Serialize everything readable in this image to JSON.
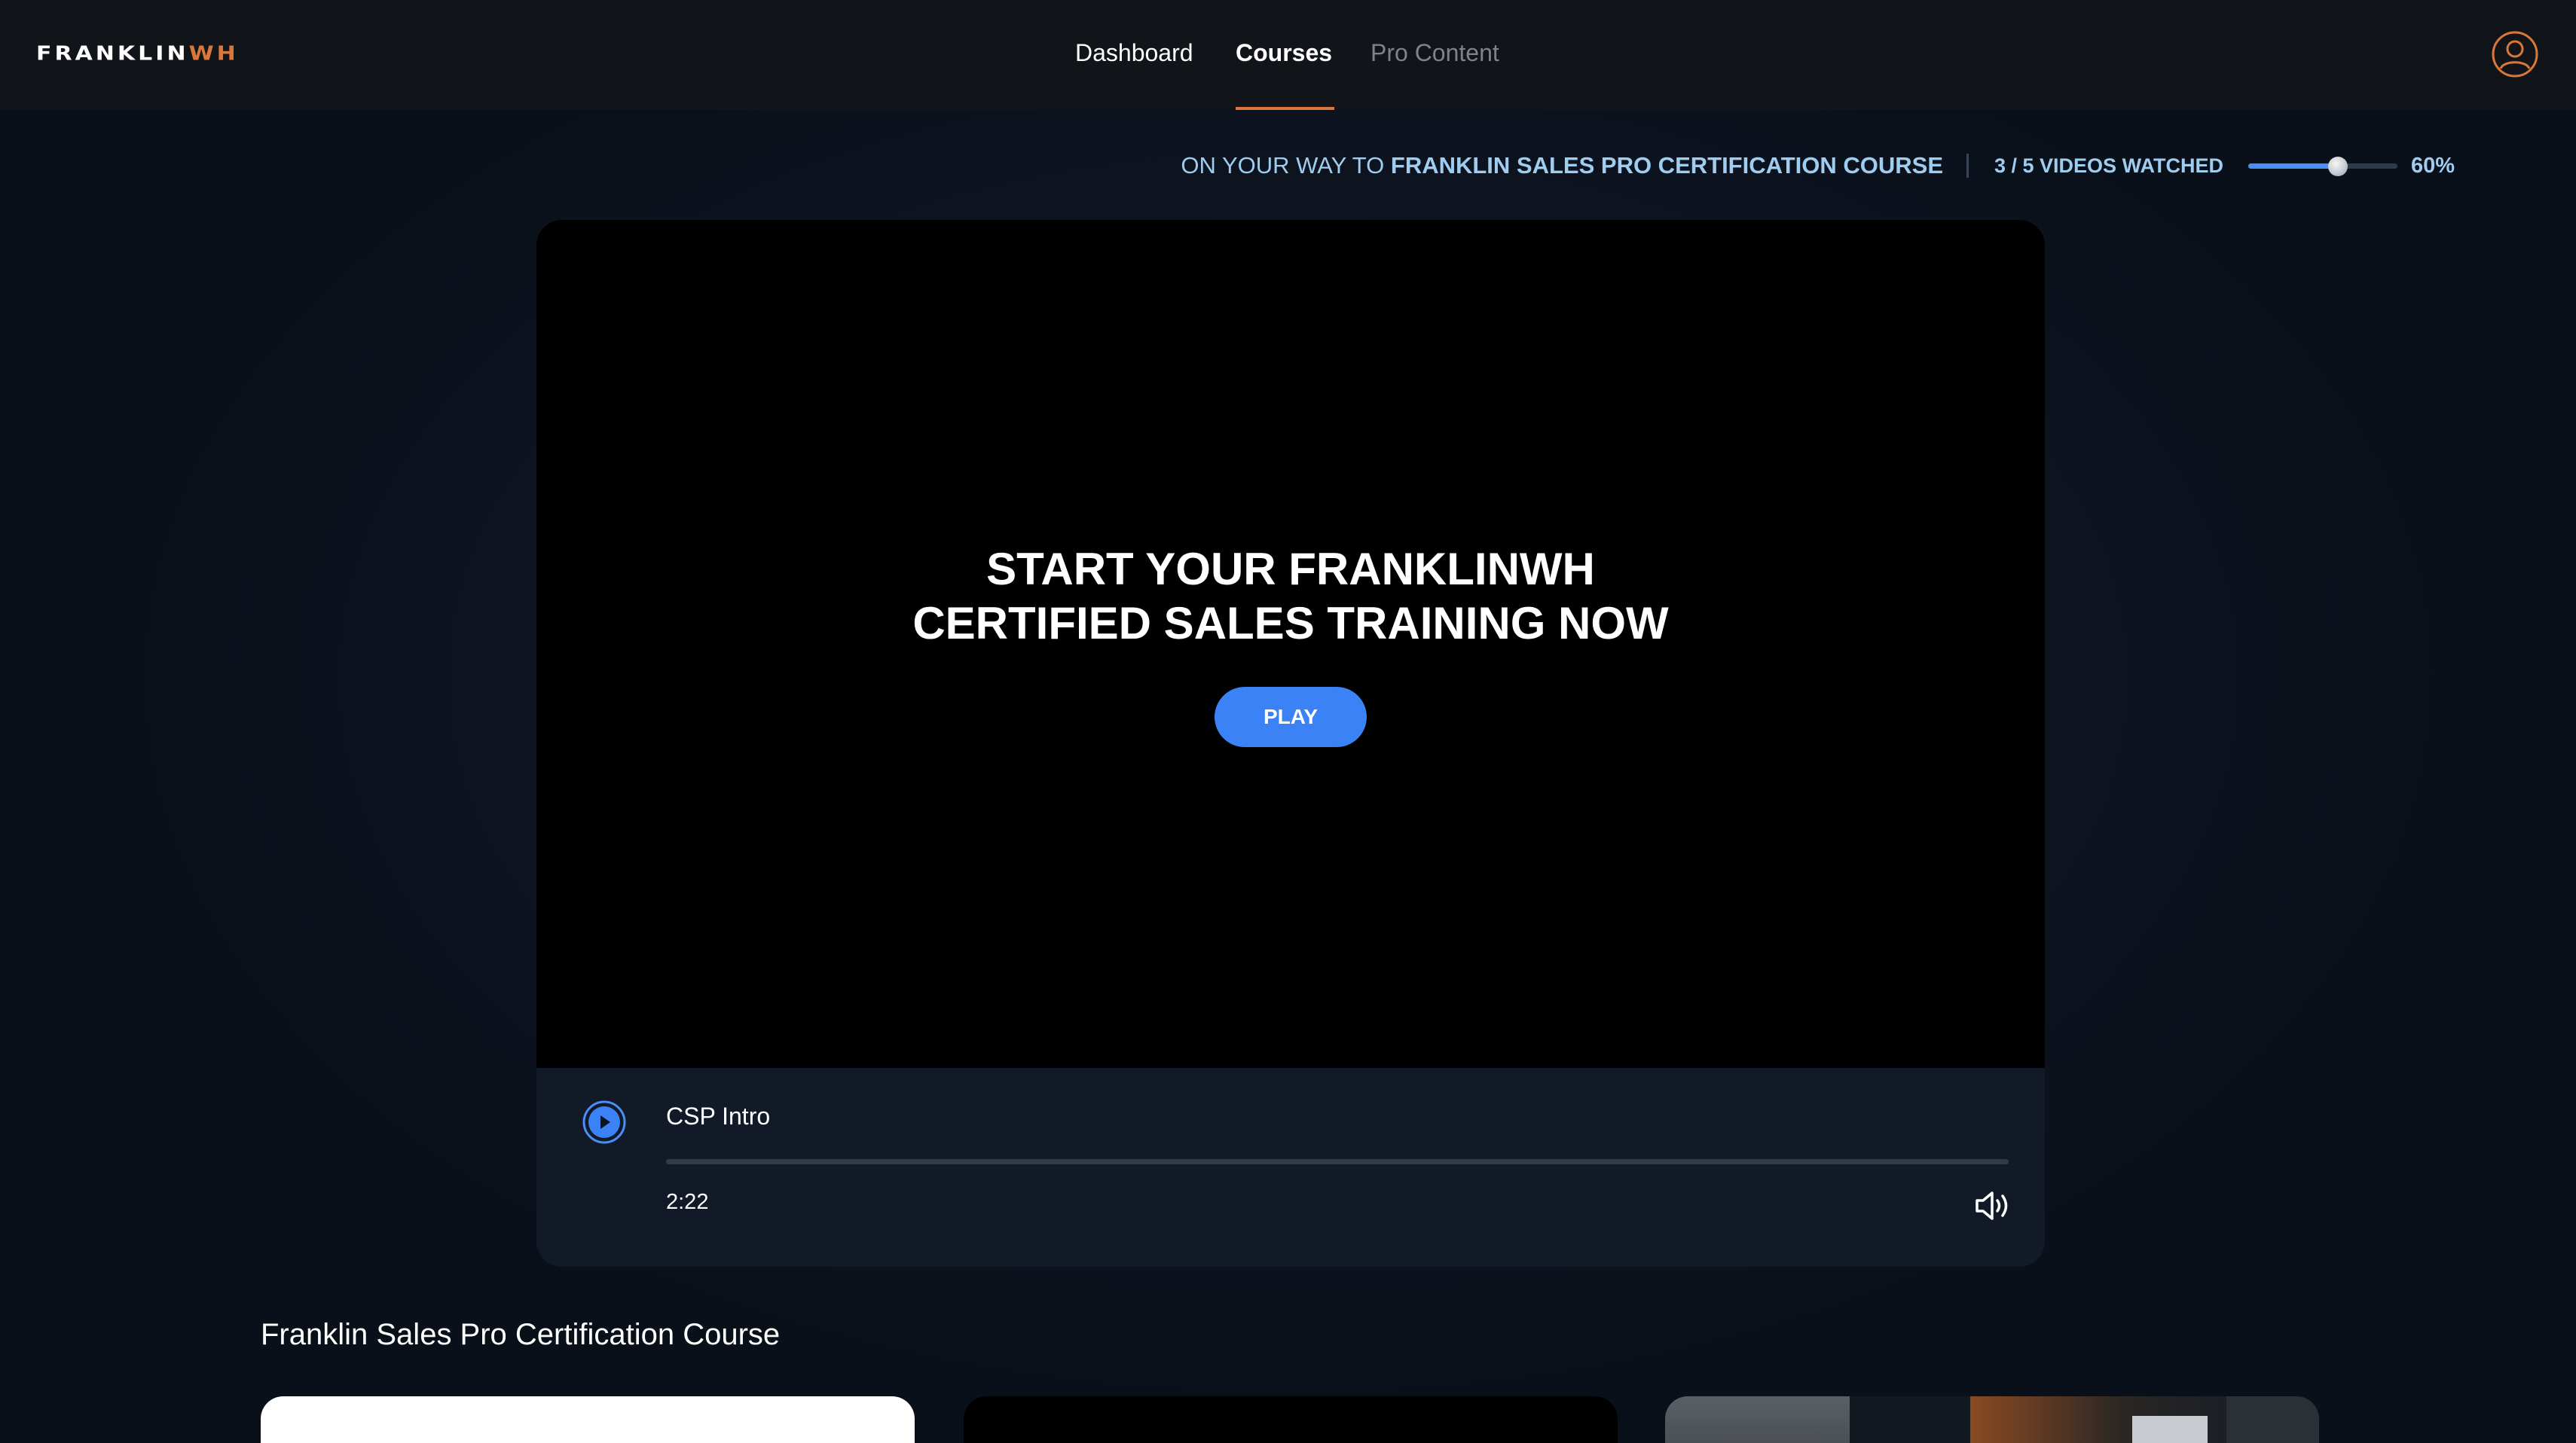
{
  "brand": {
    "logo_main": "FRANKLIN",
    "logo_accent": "WH",
    "accent_color": "#d9783a",
    "primary_color": "#3b82f6"
  },
  "nav": {
    "items": [
      {
        "label": "Dashboard",
        "active": false
      },
      {
        "label": "Courses",
        "active": true
      },
      {
        "label": "Pro Content",
        "active": false
      }
    ],
    "account_icon": "user-circle-icon"
  },
  "progress": {
    "prefix": "ON YOUR WAY TO",
    "course_name": "FRANKLIN SALES PRO CERTIFICATION COURSE",
    "watched_label": "3 / 5 VIDEOS WATCHED",
    "percent_label": "60%",
    "fraction": 0.6
  },
  "player": {
    "headline_line1": "START YOUR FRANKLINWH",
    "headline_line2": "CERTIFIED SALES TRAINING NOW",
    "play_label": "PLAY",
    "video_title": "CSP Intro",
    "duration": "2:22",
    "play_icon": "play-circle-icon",
    "volume_icon": "volume-icon"
  },
  "course_section": {
    "title": "Franklin Sales Pro Certification Course"
  }
}
